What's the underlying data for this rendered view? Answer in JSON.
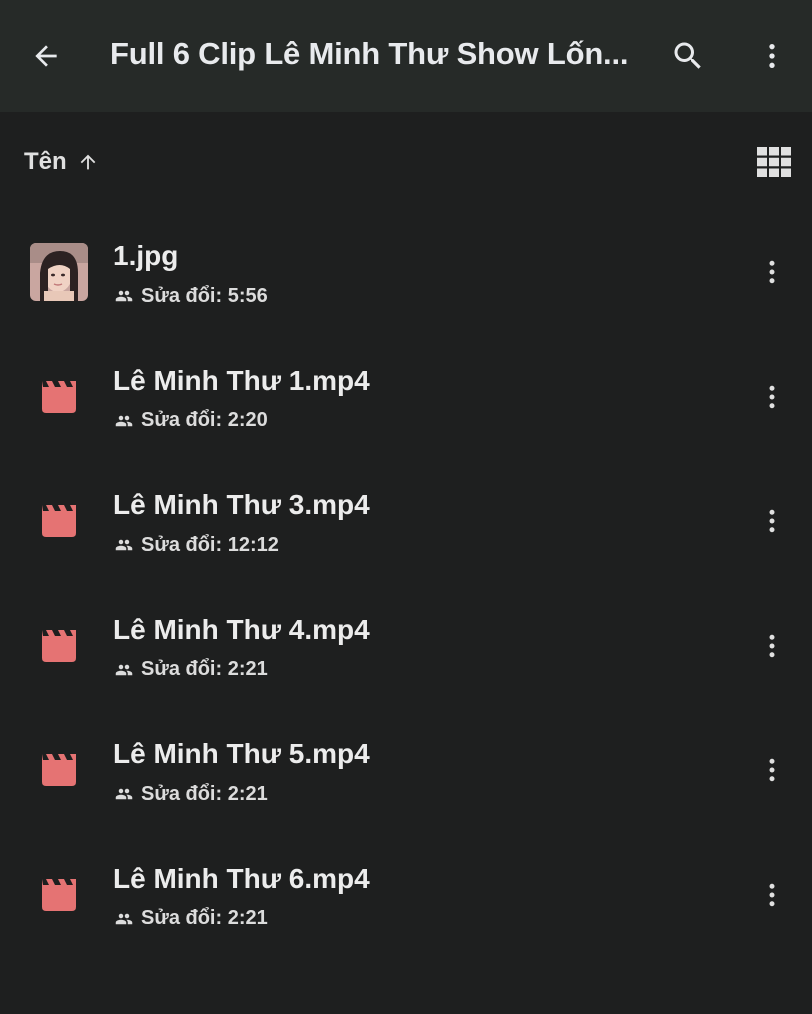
{
  "appbar": {
    "title": "Full 6 Clip Lê Minh Thư Show Lốn...",
    "back_icon": "arrow-back-icon",
    "search_icon": "search-icon",
    "more_icon": "more-vert-icon"
  },
  "sort": {
    "label": "Tên",
    "direction_icon": "arrow-up-icon",
    "view_icon": "grid-view-icon"
  },
  "colors": {
    "background": "#1e1f1f",
    "appbar": "#262a28",
    "video_icon": "#e57373",
    "text": "#e8eaed"
  },
  "files": [
    {
      "name": "1.jpg",
      "type": "image",
      "modified_label": "Sửa đổi: 5:56",
      "shared_icon": "people-icon"
    },
    {
      "name": "Lê Minh Thư 1.mp4",
      "type": "video",
      "modified_label": "Sửa đổi: 2:20",
      "shared_icon": "people-icon"
    },
    {
      "name": "Lê Minh Thư 3.mp4",
      "type": "video",
      "modified_label": "Sửa đổi: 12:12",
      "shared_icon": "people-icon"
    },
    {
      "name": "Lê Minh Thư 4.mp4",
      "type": "video",
      "modified_label": "Sửa đổi: 2:21",
      "shared_icon": "people-icon"
    },
    {
      "name": "Lê Minh Thư 5.mp4",
      "type": "video",
      "modified_label": "Sửa đổi: 2:21",
      "shared_icon": "people-icon"
    },
    {
      "name": "Lê Minh Thư 6.mp4",
      "type": "video",
      "modified_label": "Sửa đổi: 2:21",
      "shared_icon": "people-icon"
    }
  ]
}
